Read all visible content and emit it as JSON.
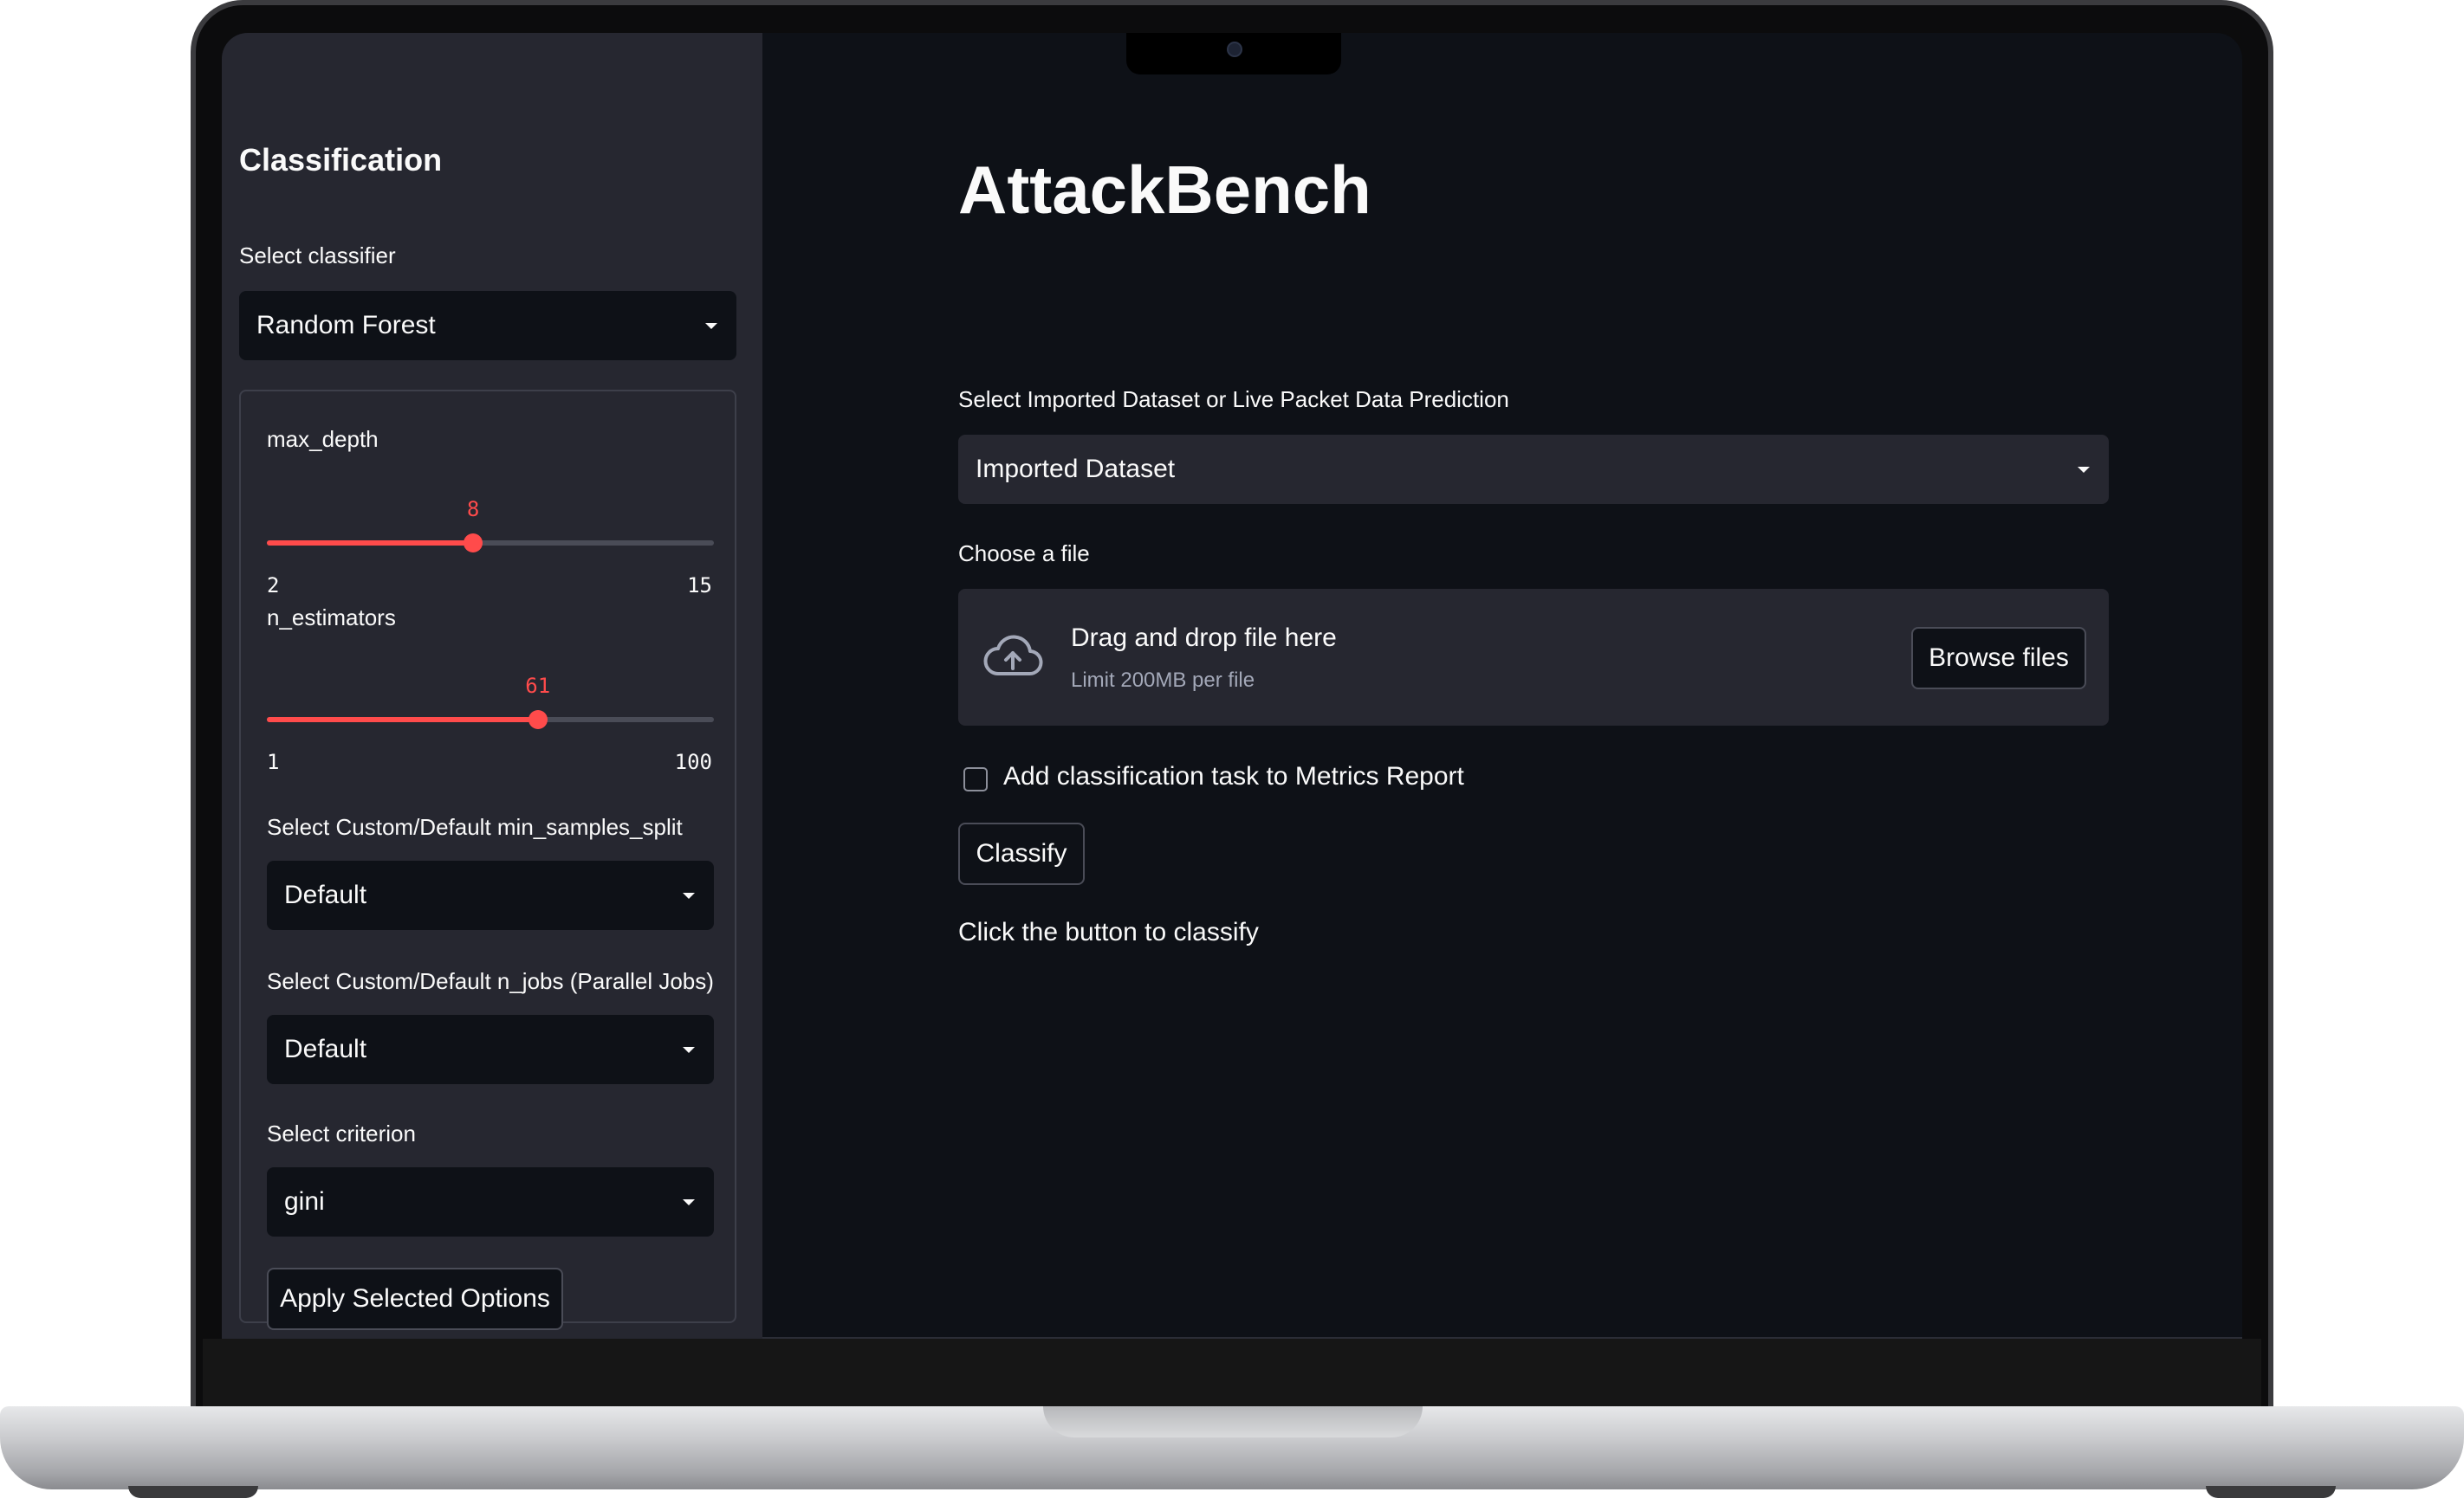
{
  "sidebar": {
    "title": "Classification",
    "classifier_label": "Select classifier",
    "classifier_value": "Random Forest",
    "max_depth": {
      "label": "max_depth",
      "value": "8",
      "min": "2",
      "max": "15",
      "fraction": 0.4615
    },
    "n_estimators": {
      "label": "n_estimators",
      "value": "61",
      "min": "1",
      "max": "100",
      "fraction": 0.6061
    },
    "min_samples_split": {
      "label": "Select Custom/Default min_samples_split",
      "value": "Default"
    },
    "n_jobs": {
      "label": "Select Custom/Default n_jobs (Parallel Jobs)",
      "value": "Default"
    },
    "criterion": {
      "label": "Select criterion",
      "value": "gini"
    },
    "apply_button": "Apply Selected Options"
  },
  "main": {
    "title": "AttackBench",
    "source_label": "Select Imported Dataset or Live Packet Data Prediction",
    "source_value": "Imported Dataset",
    "file_label": "Choose a file",
    "drop_title": "Drag and drop file here",
    "drop_limit": "Limit 200MB per file",
    "browse_button": "Browse files",
    "checkbox_label": "Add classification task to Metrics Report",
    "classify_button": "Classify",
    "info_text": "Click the button to classify"
  },
  "colors": {
    "accent": "#ff4b4b",
    "background": "#0e1117",
    "sidebar": "#262730"
  },
  "icons": [
    "upload-cloud-icon",
    "chevron-down-icon",
    "camera-icon"
  ]
}
